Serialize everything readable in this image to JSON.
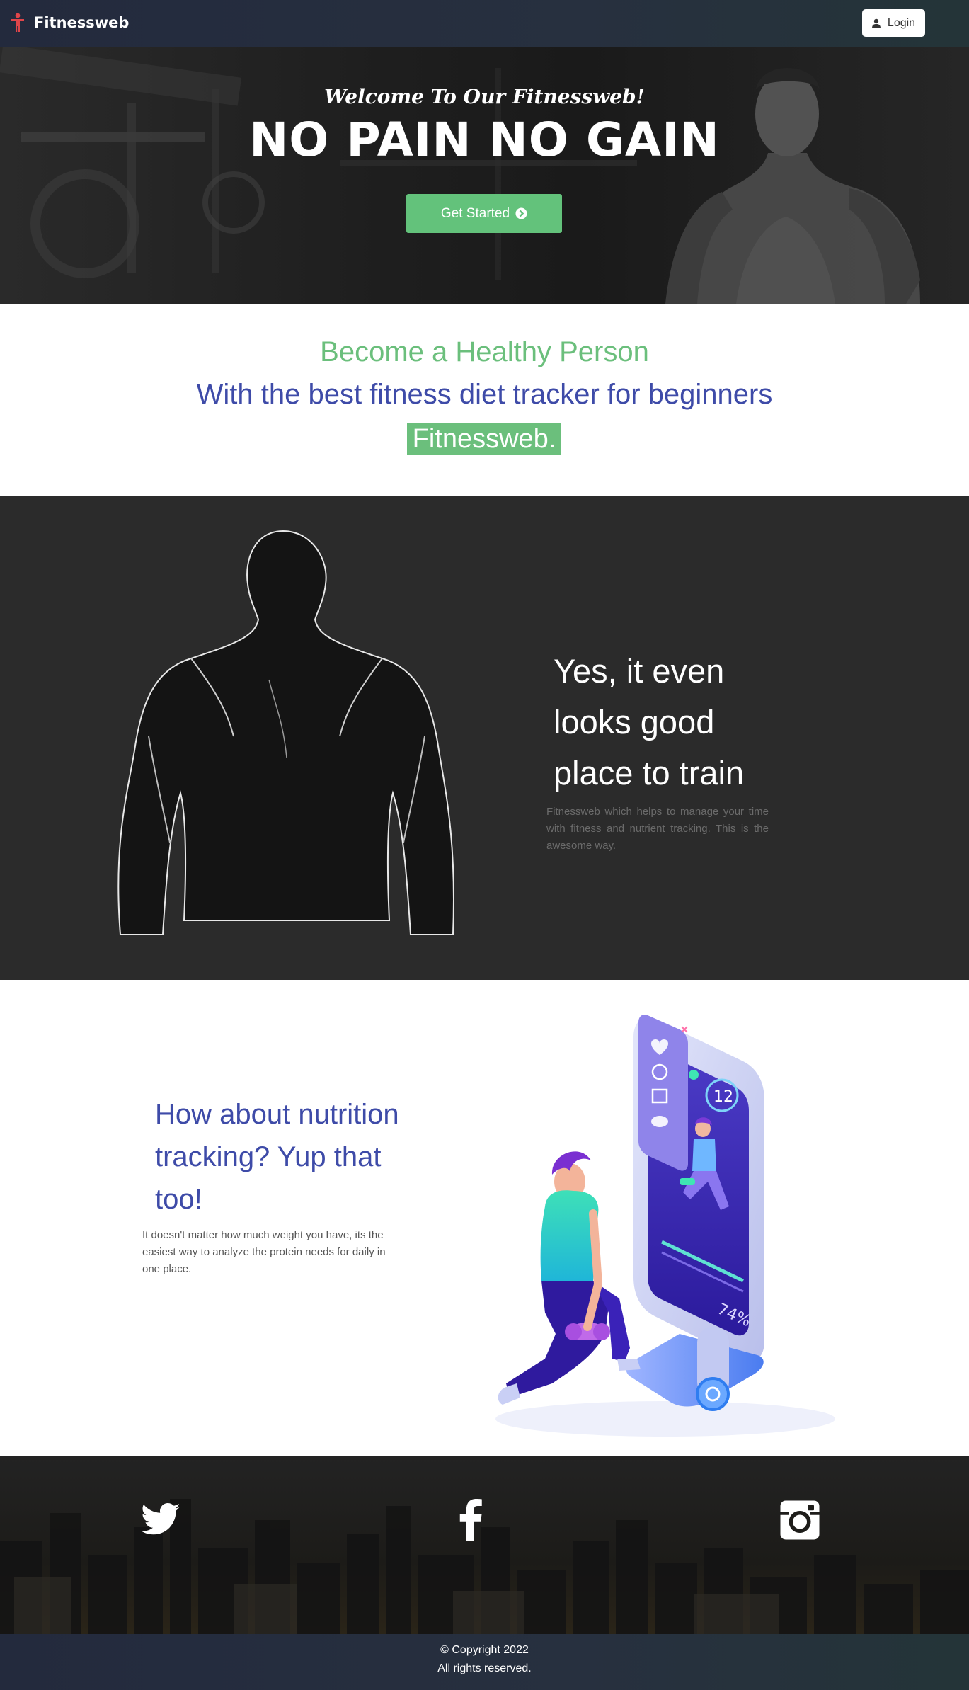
{
  "navbar": {
    "brand": "Fitnessweb",
    "brand_icon": "person-figure-icon",
    "login_label": "Login",
    "login_icon": "user-icon"
  },
  "hero": {
    "welcome": "Welcome To Our Fitnessweb!",
    "title": "NO PAIN NO GAIN",
    "cta_label": "Get Started",
    "cta_icon": "chevron-circle-right-icon",
    "cta_color": "#63c27b"
  },
  "tagline": {
    "line1": "Become a Healthy Person",
    "line2": "With the best fitness diet tracker for beginners",
    "highlight": "Fitnessweb.",
    "green": "#6bbf7c",
    "blue": "#3e4ba8"
  },
  "feature_train": {
    "heading": "Yes, it even looks good place to train",
    "text": "Fitnessweb which helps to manage your time with fitness and nutrient tracking. This is the awesome way."
  },
  "feature_nutrition": {
    "heading": "How about nutrition tracking? Yup that too!",
    "text": "It doesn't matter how much weight you have, its the easiest way to analyze the protein needs for daily in one place.",
    "phone_timer": "12",
    "phone_progress": "74%"
  },
  "social": {
    "items": [
      "twitter-icon",
      "facebook-icon",
      "instagram-icon"
    ]
  },
  "footer": {
    "copyright": "© Copyright 2022",
    "rights": "All rights reserved."
  }
}
